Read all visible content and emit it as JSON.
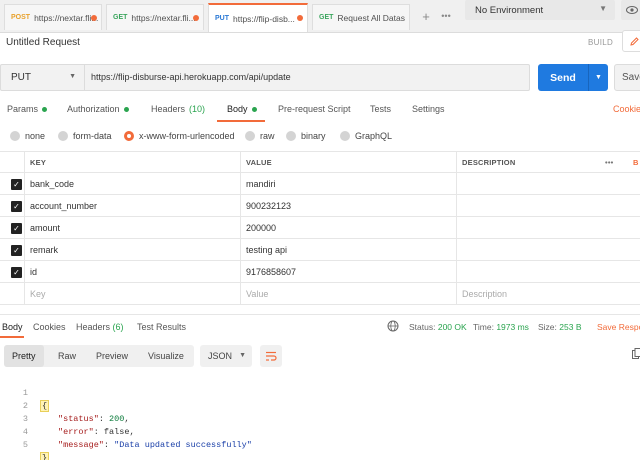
{
  "tabs": [
    {
      "method": "POST",
      "name": "https://nextar.fli..."
    },
    {
      "method": "GET",
      "name": "https://nextar.fli..."
    },
    {
      "method": "PUT",
      "name": "https://flip-disb..."
    },
    {
      "method": "GET",
      "name": "Request All Datas"
    }
  ],
  "environment": {
    "selected": "No Environment"
  },
  "request": {
    "title": "Untitled Request",
    "build_label": "BUILD",
    "method": "PUT",
    "url": "https://flip-disburse-api.herokuapp.com/api/update",
    "send_label": "Send",
    "save_label": "Save"
  },
  "subtabs": {
    "params": "Params",
    "authorization": "Authorization",
    "headers": "Headers",
    "headers_count": "(10)",
    "body": "Body",
    "prerequest": "Pre-request Script",
    "tests": "Tests",
    "settings": "Settings",
    "cookies": "Cookies"
  },
  "body_types": [
    "none",
    "form-data",
    "x-www-form-urlencoded",
    "raw",
    "binary",
    "GraphQL"
  ],
  "params": {
    "headers": {
      "key": "KEY",
      "value": "VALUE",
      "description": "DESCRIPTION",
      "more": "•••",
      "bulk": "B"
    },
    "rows": [
      {
        "key": "bank_code",
        "value": "mandiri"
      },
      {
        "key": "account_number",
        "value": "900232123"
      },
      {
        "key": "amount",
        "value": "200000"
      },
      {
        "key": "remark",
        "value": "testing api"
      },
      {
        "key": "id",
        "value": "9176858607"
      }
    ],
    "placeholder": {
      "key": "Key",
      "value": "Value",
      "description": "Description"
    }
  },
  "response": {
    "tabs": {
      "body": "Body",
      "cookies": "Cookies",
      "headers": "Headers",
      "headers_count": "(6)",
      "test_results": "Test Results"
    },
    "status_label": "Status:",
    "status_value": "200 OK",
    "time_label": "Time:",
    "time_value": "1973 ms",
    "size_label": "Size:",
    "size_value": "253 B",
    "save_label": "Save Respo",
    "views": [
      "Pretty",
      "Raw",
      "Preview",
      "Visualize"
    ],
    "format": "JSON",
    "code": {
      "line_numbers": [
        "1",
        "2",
        "3",
        "4",
        "5"
      ],
      "open": "{",
      "close": "}",
      "status_key": "\"status\"",
      "status_val": "200",
      "error_key": "\"error\"",
      "error_val": "false",
      "message_key": "\"message\"",
      "message_val": "\"Data updated successfully\""
    }
  },
  "colors": {
    "accent": "#f26b3a",
    "send": "#1f7ae0",
    "success": "#2aa44f"
  }
}
